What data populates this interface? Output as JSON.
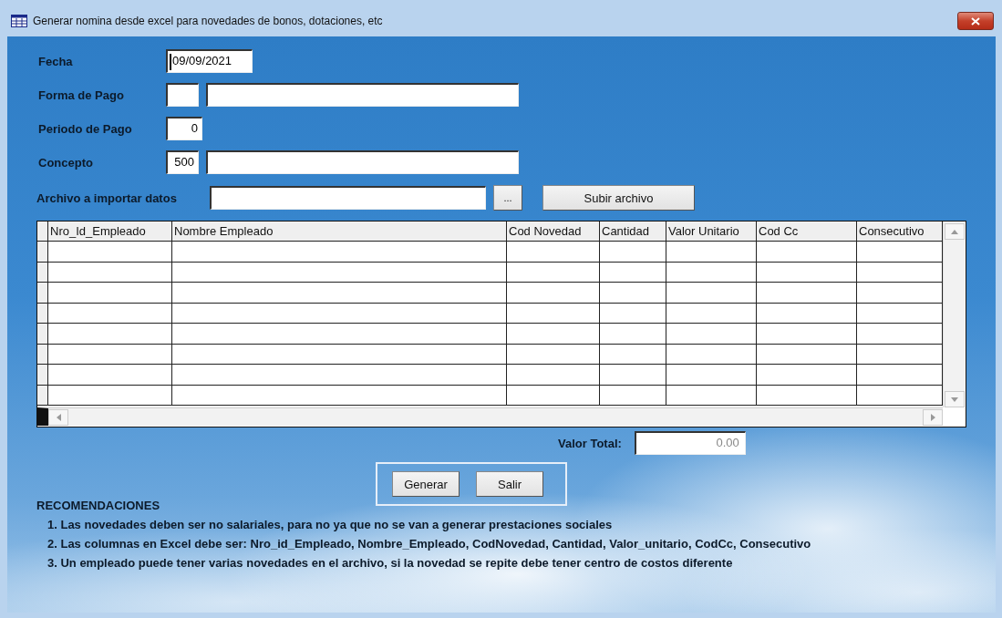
{
  "window": {
    "title": "Generar nomina desde excel para novedades de bonos, dotaciones, etc"
  },
  "fields": [
    {
      "label": "Fecha",
      "kind": "date",
      "inputs": [
        {
          "value": "09/09/2021",
          "focused": true
        }
      ]
    },
    {
      "label": "Forma de Pago",
      "kind": "code-name",
      "inputs": [
        {
          "focused": false
        },
        {
          "focused": false
        }
      ]
    },
    {
      "label": "Periodo de Pago",
      "kind": "number",
      "inputs": [
        {
          "value": "0",
          "focused": false
        }
      ]
    },
    {
      "label": "Concepto",
      "kind": "code-name",
      "inputs": [
        {
          "value": "500",
          "focused": false
        },
        {
          "focused": false
        }
      ]
    }
  ],
  "file_import": {
    "label": "Archivo a importar datos",
    "browse_button": "...",
    "upload_button": "Subir archivo"
  },
  "table": {
    "columns": [
      "Nro_Id_Empleado",
      "Nombre Empleado",
      "Cod Novedad",
      "Cantidad",
      "Valor Unitario",
      "Cod Cc",
      "Consecutivo"
    ]
  },
  "total": {
    "label": "Valor Total:",
    "value": "0.00",
    "disabled": true
  },
  "buttons": [
    "Generar",
    "Salir"
  ],
  "recommendations": {
    "title": "RECOMENDACIONES",
    "items": [
      "1. Las novedades deben ser no salariales, para no ya que no se van a generar prestaciones sociales",
      "2. Las columnas en Excel debe ser: Nro_id_Empleado, Nombre_Empleado, CodNovedad, Cantidad, Valor_unitario, CodCc, Consecutivo",
      "3. Un empleado puede tener varias novedades en el archivo, si la novedad se repite debe tener centro de costos diferente"
    ]
  }
}
